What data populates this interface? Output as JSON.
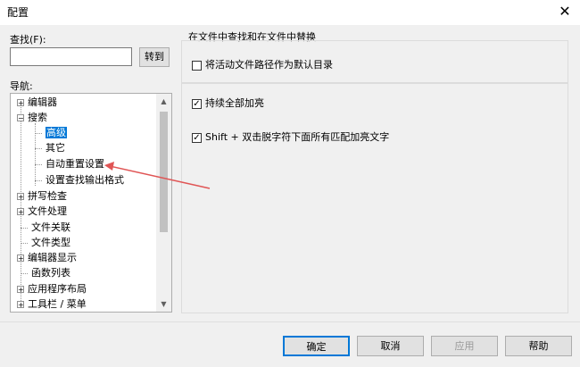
{
  "window": {
    "title": "配置",
    "close_symbol": "✕"
  },
  "search": {
    "label": "查找(F):",
    "value": "",
    "goto_label": "转到"
  },
  "nav": {
    "label": "导航:",
    "items": [
      {
        "label": "编辑器",
        "expander": "+"
      },
      {
        "label": "搜索",
        "expander": "−"
      },
      {
        "label": "高级",
        "selected": true
      },
      {
        "label": "其它"
      },
      {
        "label": "自动重置设置"
      },
      {
        "label": "设置查找输出格式"
      },
      {
        "label": "拼写检查",
        "expander": "+"
      },
      {
        "label": "文件处理",
        "expander": "+"
      },
      {
        "label": "文件关联"
      },
      {
        "label": "文件类型"
      },
      {
        "label": "编辑器显示",
        "expander": "+"
      },
      {
        "label": "函数列表"
      },
      {
        "label": "应用程序布局",
        "expander": "+"
      },
      {
        "label": "工具栏 / 菜单",
        "expander": "+"
      }
    ]
  },
  "panel": {
    "title": "在文件中查找和在文件中替换",
    "options": [
      {
        "label": "将活动文件路径作为默认目录",
        "checked": false
      },
      {
        "label": "持续全部加亮",
        "checked": true
      },
      {
        "label": "Shift + 双击脱字符下面所有匹配加亮文字",
        "checked": true
      }
    ]
  },
  "footer": {
    "ok_label": "确定",
    "cancel_label": "取消",
    "apply_label": "应用",
    "help_label": "帮助"
  },
  "colors": {
    "accent": "#0078d7",
    "annotation": "#e05555"
  }
}
